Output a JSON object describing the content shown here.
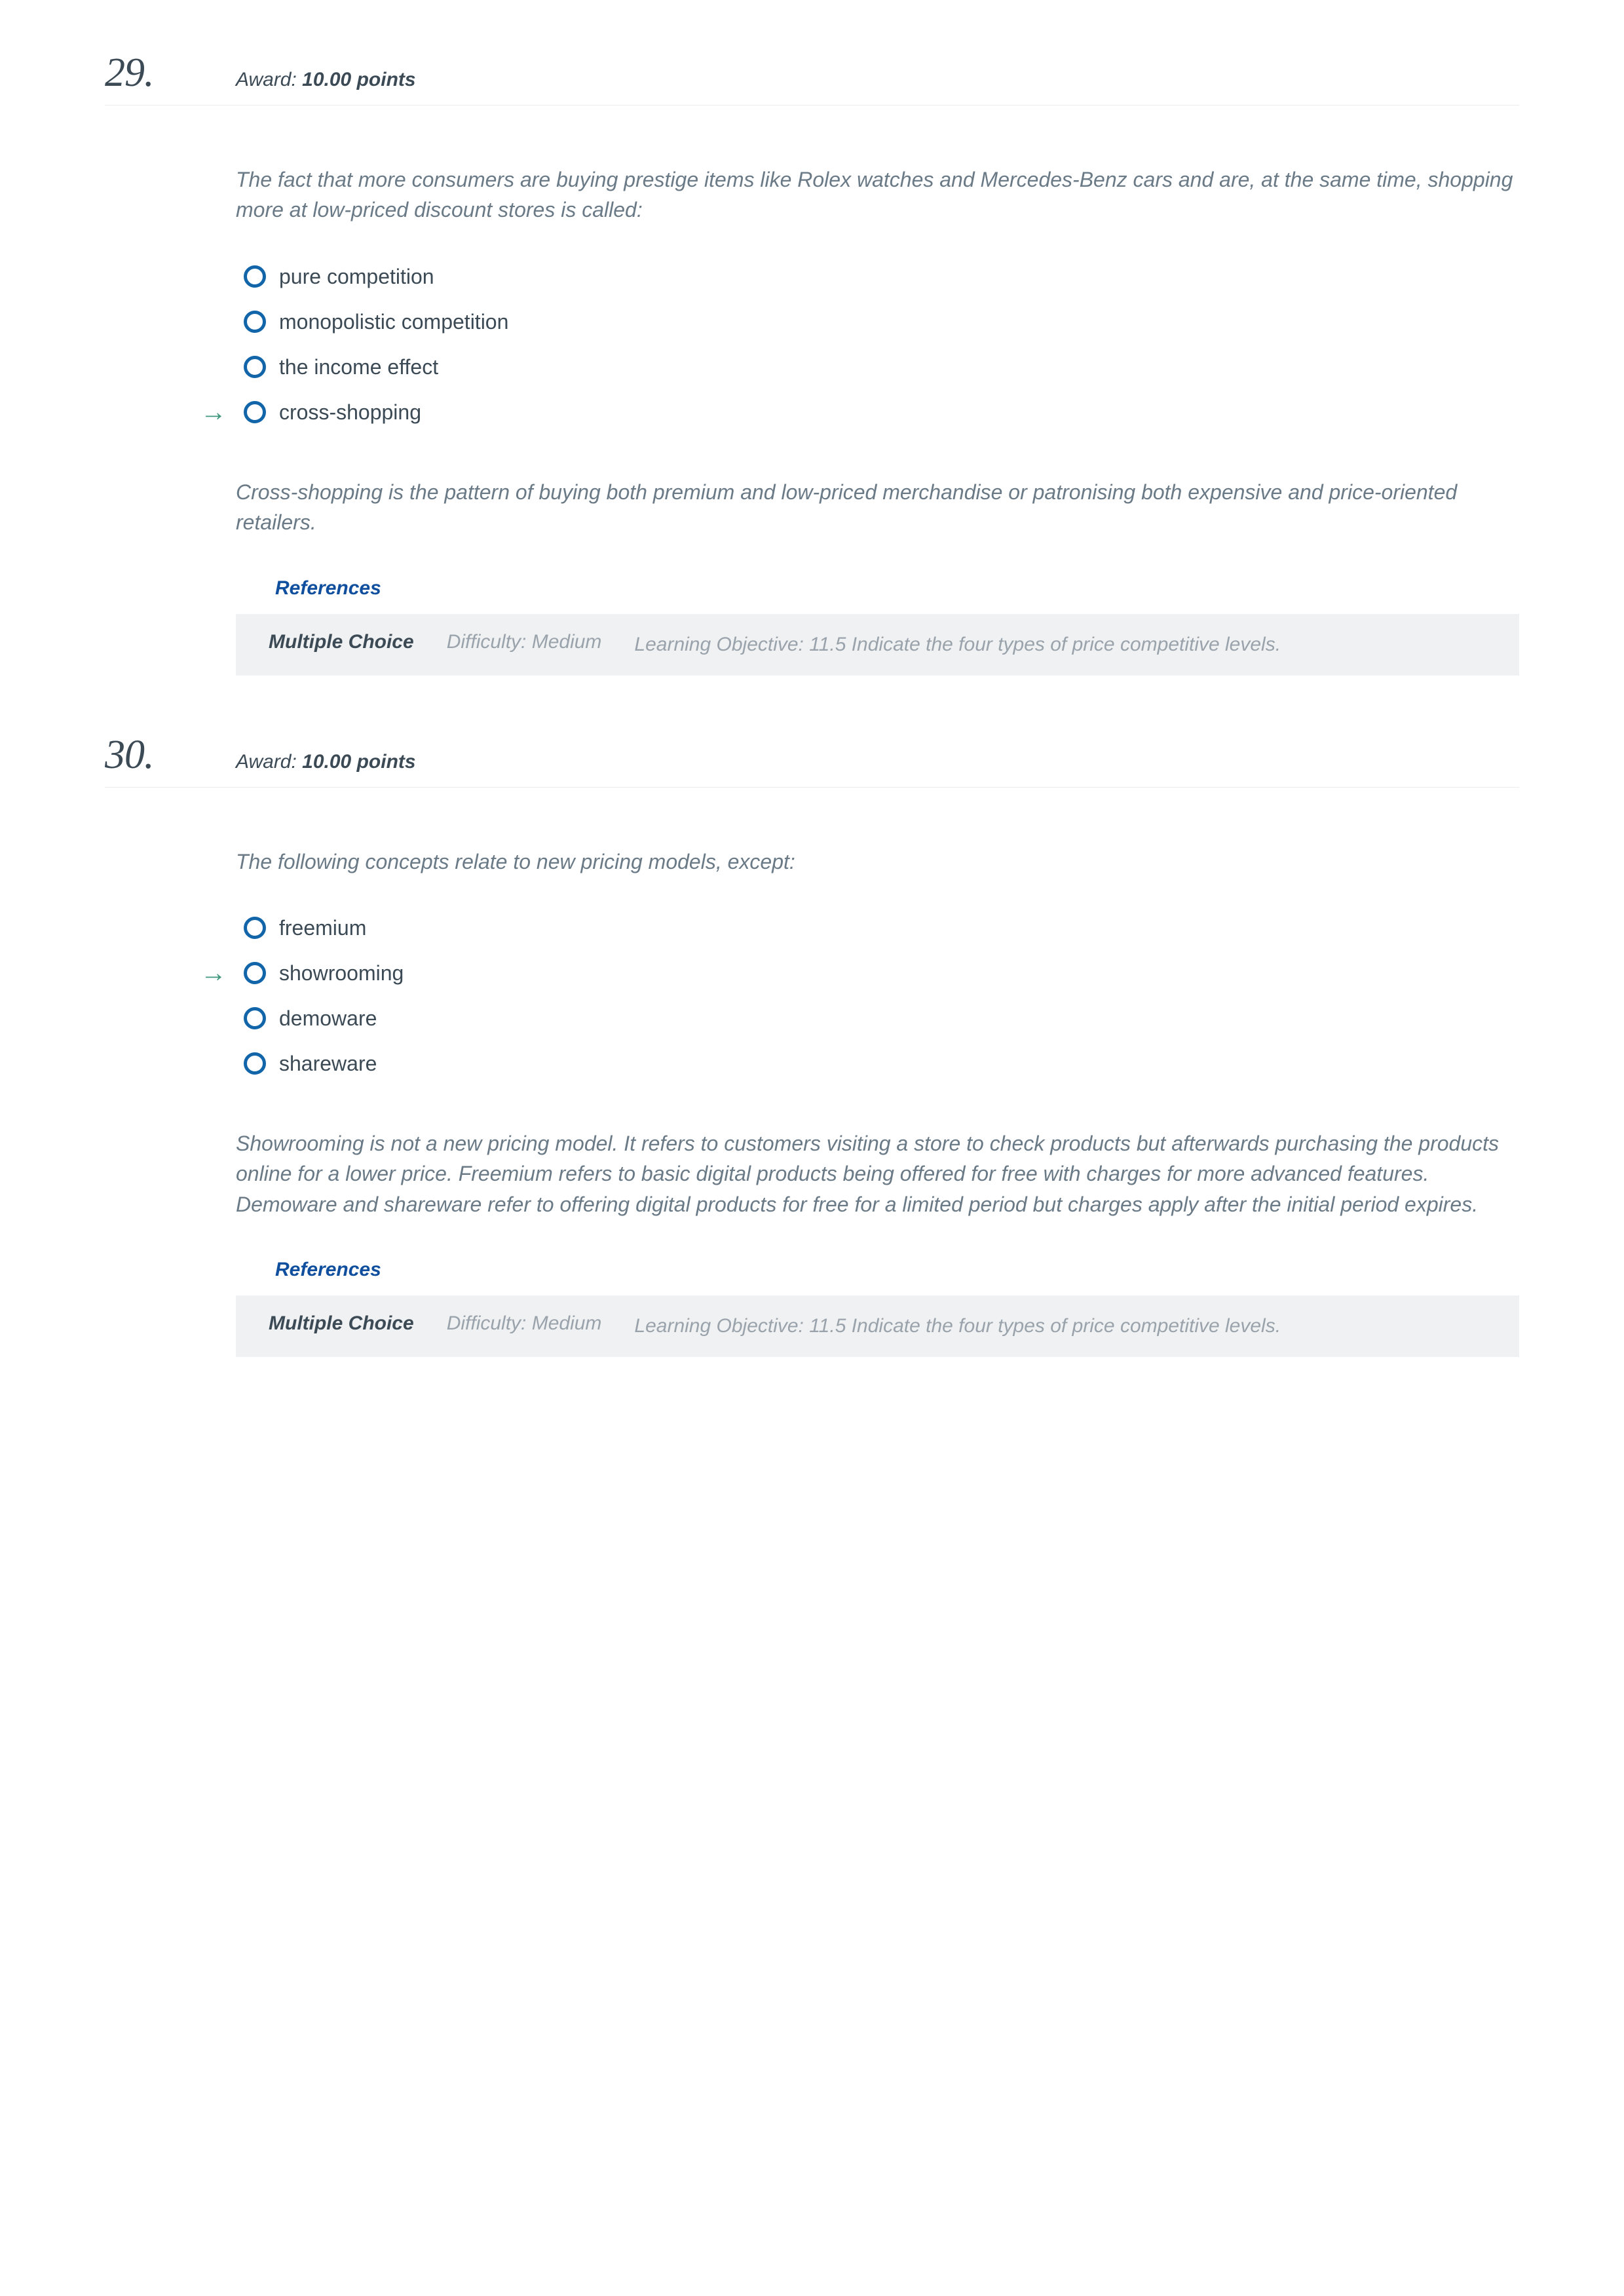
{
  "questions": [
    {
      "number": "29.",
      "award_prefix": "Award: ",
      "award_points": "10.00 points",
      "stem": "The fact that more consumers are buying prestige items like Rolex watches and Mercedes-Benz cars and are, at the same time, shopping more at low-priced discount stores is called:",
      "choices": [
        {
          "label": "pure competition",
          "correct": false
        },
        {
          "label": "monopolistic competition",
          "correct": false
        },
        {
          "label": "the income effect",
          "correct": false
        },
        {
          "label": "cross-shopping",
          "correct": true
        }
      ],
      "explanation": "Cross-shopping is the pattern of buying both premium and low-priced merchandise or patronising both expensive and price-oriented retailers.",
      "references": {
        "heading": "References",
        "type": "Multiple Choice",
        "difficulty": "Difficulty: Medium",
        "learning_objective": "Learning Objective: 11.5 Indicate the four types of price competitive levels."
      }
    },
    {
      "number": "30.",
      "award_prefix": "Award: ",
      "award_points": "10.00 points",
      "stem": "The following concepts relate to new pricing models, except:",
      "choices": [
        {
          "label": "freemium",
          "correct": false
        },
        {
          "label": "showrooming",
          "correct": true
        },
        {
          "label": "demoware",
          "correct": false
        },
        {
          "label": "shareware",
          "correct": false
        }
      ],
      "explanation": "Showrooming is not a new pricing model. It refers to customers visiting a store to check products but afterwards purchasing the products online for a lower price. Freemium refers to basic digital products being offered for free with charges for more advanced features. Demoware and shareware refer to offering digital products for free for a limited period but charges apply after the initial period expires.",
      "references": {
        "heading": "References",
        "type": "Multiple Choice",
        "difficulty": "Difficulty: Medium",
        "learning_objective": "Learning Objective: 11.5 Indicate the four types of price competitive levels."
      }
    }
  ],
  "arrow_glyph": "→"
}
